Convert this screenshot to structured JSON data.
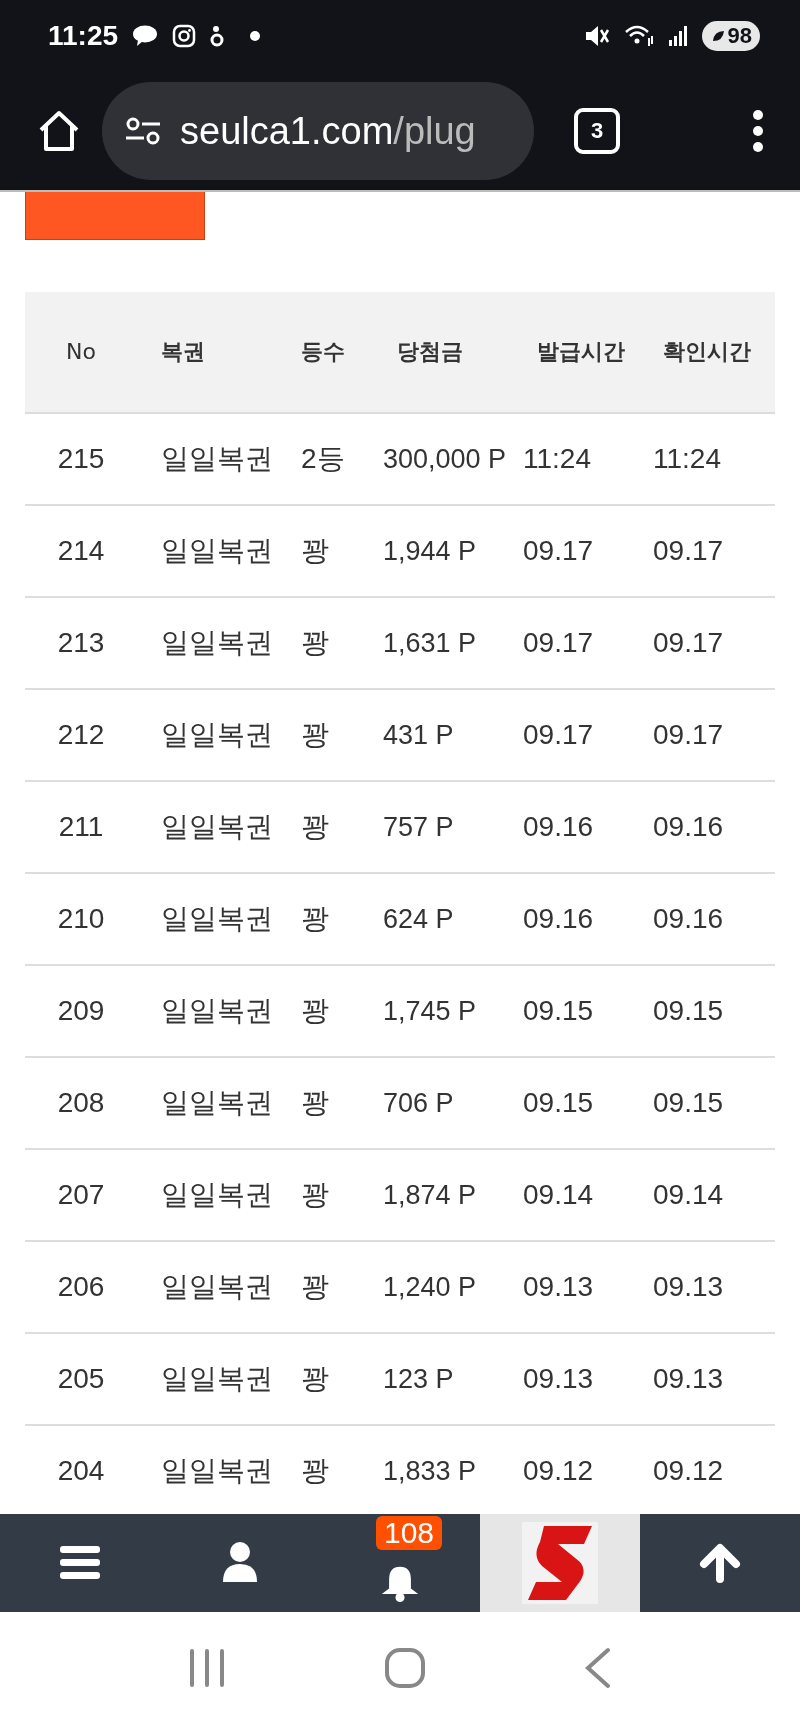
{
  "status_bar": {
    "time": "11:25",
    "battery": "98"
  },
  "browser": {
    "url_domain": "seulca1.com",
    "url_path": "/plug",
    "tab_count": "3"
  },
  "table": {
    "columns": [
      "No",
      "복권",
      "등수",
      "당첨금",
      "발급시간",
      "확인시간"
    ],
    "rows": [
      {
        "no": "215",
        "lottery": "일일복권",
        "rank": "2등",
        "prize": "300,000 P",
        "issued": "11:24",
        "checked": "11:24"
      },
      {
        "no": "214",
        "lottery": "일일복권",
        "rank": "꽝",
        "prize": "1,944 P",
        "issued": "09.17",
        "checked": "09.17"
      },
      {
        "no": "213",
        "lottery": "일일복권",
        "rank": "꽝",
        "prize": "1,631 P",
        "issued": "09.17",
        "checked": "09.17"
      },
      {
        "no": "212",
        "lottery": "일일복권",
        "rank": "꽝",
        "prize": "431 P",
        "issued": "09.17",
        "checked": "09.17"
      },
      {
        "no": "211",
        "lottery": "일일복권",
        "rank": "꽝",
        "prize": "757 P",
        "issued": "09.16",
        "checked": "09.16"
      },
      {
        "no": "210",
        "lottery": "일일복권",
        "rank": "꽝",
        "prize": "624 P",
        "issued": "09.16",
        "checked": "09.16"
      },
      {
        "no": "209",
        "lottery": "일일복권",
        "rank": "꽝",
        "prize": "1,745 P",
        "issued": "09.15",
        "checked": "09.15"
      },
      {
        "no": "208",
        "lottery": "일일복권",
        "rank": "꽝",
        "prize": "706 P",
        "issued": "09.15",
        "checked": "09.15"
      },
      {
        "no": "207",
        "lottery": "일일복권",
        "rank": "꽝",
        "prize": "1,874 P",
        "issued": "09.14",
        "checked": "09.14"
      },
      {
        "no": "206",
        "lottery": "일일복권",
        "rank": "꽝",
        "prize": "1,240 P",
        "issued": "09.13",
        "checked": "09.13"
      },
      {
        "no": "205",
        "lottery": "일일복권",
        "rank": "꽝",
        "prize": "123 P",
        "issued": "09.13",
        "checked": "09.13"
      },
      {
        "no": "204",
        "lottery": "일일복권",
        "rank": "꽝",
        "prize": "1,833 P",
        "issued": "09.12",
        "checked": "09.12"
      }
    ]
  },
  "bottom_nav": {
    "notification_count": "108"
  }
}
